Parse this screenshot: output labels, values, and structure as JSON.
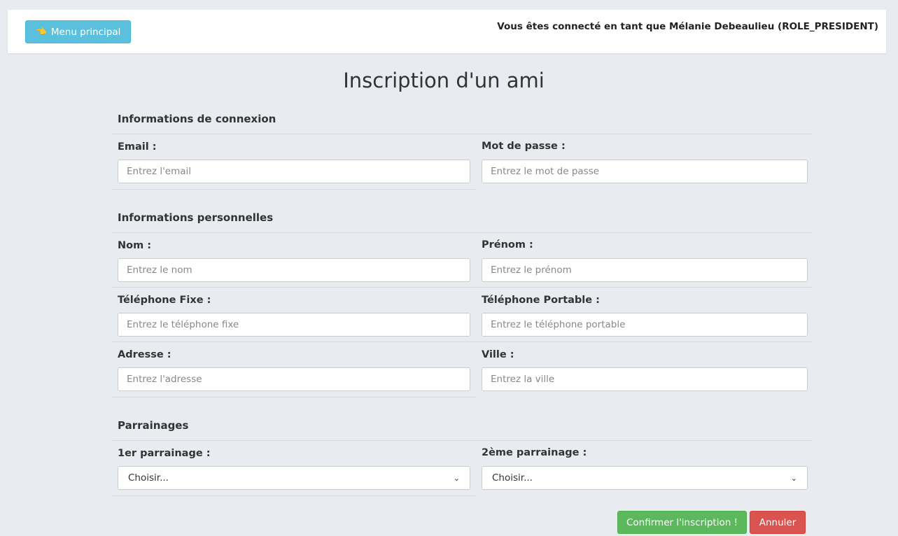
{
  "header": {
    "menu_label": "Menu principal",
    "menu_icon": "pointing-hand-icon",
    "user_info": "Vous êtes connecté en tant que Mélanie Debeaulieu (ROLE_PRESIDENT)"
  },
  "page": {
    "title": "Inscription d'un ami"
  },
  "sections": {
    "connexion": {
      "title": "Informations de connexion",
      "email_label": "Email :",
      "email_placeholder": "Entrez l'email",
      "password_label": "Mot de passe :",
      "password_placeholder": "Entrez le mot de passe"
    },
    "personnelles": {
      "title": "Informations personnelles",
      "nom_label": "Nom :",
      "nom_placeholder": "Entrez le nom",
      "prenom_label": "Prénom :",
      "prenom_placeholder": "Entrez le prénom",
      "tel_fixe_label": "Téléphone Fixe :",
      "tel_fixe_placeholder": "Entrez le téléphone fixe",
      "tel_portable_label": "Téléphone Portable :",
      "tel_portable_placeholder": "Entrez le téléphone portable",
      "adresse_label": "Adresse :",
      "adresse_placeholder": "Entrez l'adresse",
      "ville_label": "Ville :",
      "ville_placeholder": "Entrez la ville"
    },
    "parrainages": {
      "title": "Parrainages",
      "p1_label": "1er parrainage :",
      "p1_value": "Choisir...",
      "p2_label": "2ème parrainage :",
      "p2_value": "Choisir..."
    }
  },
  "actions": {
    "confirm_label": "Confirmer l'inscription !",
    "cancel_label": "Annuler"
  },
  "colors": {
    "info": "#5bc0de",
    "success": "#5cb85c",
    "danger": "#d9534f",
    "background": "#e8ebf0"
  }
}
